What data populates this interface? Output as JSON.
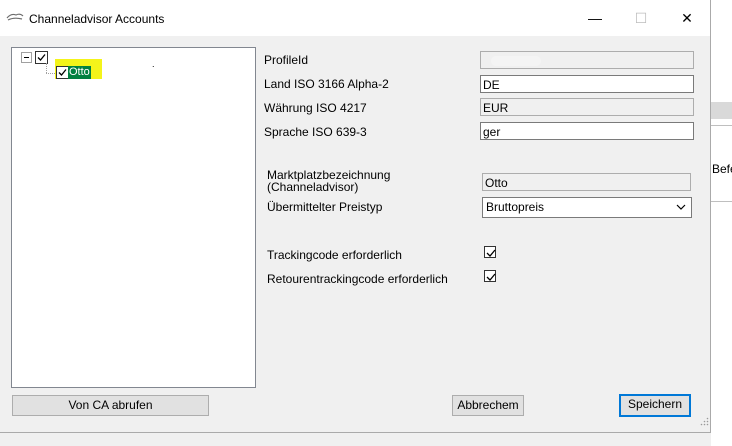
{
  "window": {
    "title": "Channeladvisor Accounts",
    "controls": {
      "minimize": "—",
      "maximize": "☐",
      "close": "✕"
    }
  },
  "tree": {
    "root_checked": true,
    "child": {
      "label": "Otto",
      "checked": true,
      "selected": true
    }
  },
  "form": {
    "profile_id": {
      "label": "ProfileId",
      "value": ""
    },
    "land": {
      "label": "Land ISO 3166 Alpha-2",
      "value": "DE"
    },
    "waehrung": {
      "label": "Währung ISO 4217",
      "value": "EUR"
    },
    "sprache": {
      "label": "Sprache ISO 639-3",
      "value": "ger"
    },
    "marktplatz": {
      "label_line1": "Marktplatzbezeichnung",
      "label_line2": "(Channeladvisor)",
      "value": "Otto"
    },
    "preistyp": {
      "label": "Übermittelter Preistyp",
      "value": "Bruttopreis"
    },
    "tracking": {
      "label": "Trackingcode erforderlich",
      "checked": true
    },
    "retouren": {
      "label": "Retourentrackingcode erforderlich",
      "checked": true
    }
  },
  "buttons": {
    "fetch": "Von CA abrufen",
    "cancel": "Abbrechem",
    "save": "Speichern"
  },
  "background_window": {
    "partial_text": "Befeh"
  },
  "colors": {
    "accent": "#0078d7",
    "selection": "#008040",
    "highlight": "#f4f41a"
  }
}
